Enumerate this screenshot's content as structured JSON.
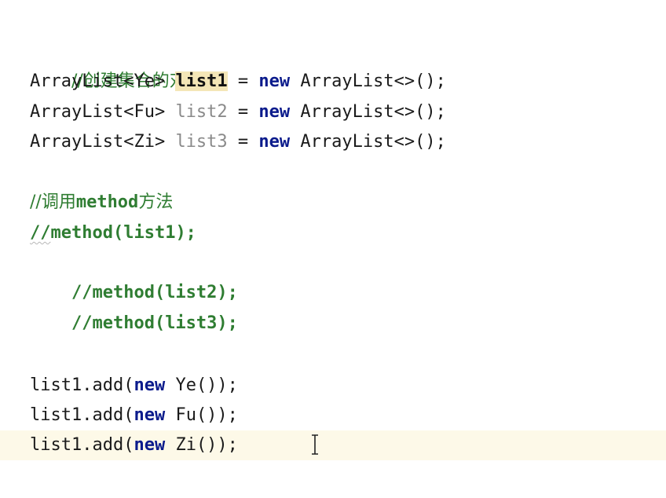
{
  "lines": [
    {
      "comment": "//创建集合的对象"
    },
    {
      "type1": "ArrayList<Ye> ",
      "var": "list1",
      "mid": " = ",
      "kw": "new",
      "ctor": " ArrayList<>();"
    },
    {
      "type1": "ArrayList<Fu> ",
      "var": "list2",
      "mid": " = ",
      "kw": "new",
      "ctor": " ArrayList<>();"
    },
    {
      "type1": "ArrayList<Zi> ",
      "var": "list3",
      "mid": " = ",
      "kw": "new",
      "ctor": " ArrayList<>();"
    },
    {
      "comment_a": "//调用",
      "comment_b": "method",
      "comment_c": "方法"
    },
    {
      "slashes": "//",
      "rest": "method(list1);"
    },
    {
      "text": "//method(list2);"
    },
    {
      "text": "//method(list3);"
    },
    {
      "pre": "list1.add(",
      "kw": "new",
      "post": " Ye());"
    },
    {
      "pre": "list1.add(",
      "kw": "new",
      "post": " Fu());"
    },
    {
      "pre": "list1.add(",
      "kw": "new",
      "post": " Zi());"
    }
  ],
  "colors": {
    "comment": "#2f7d32",
    "keyword": "#0b1b8c",
    "highlight": "#f4e6b7",
    "current_line": "#fdf9e8",
    "unused_variable": "#8a8a8a"
  },
  "icons": {
    "caret": "i-beam-cursor-icon"
  }
}
